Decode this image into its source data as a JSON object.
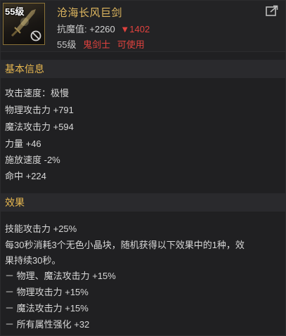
{
  "item": {
    "icon_level": "55级",
    "name": "沧海长风巨剑",
    "resist_label": "抗魔值:",
    "resist_value": "+2260",
    "resist_down": "▼1402",
    "level": "55级",
    "class": "鬼剑士",
    "usable": "可使用"
  },
  "colors": {
    "name": "#e0b860",
    "section_title": "#e8b850",
    "warning_red": "#e0423e",
    "text": "#d8d8d8"
  },
  "sections": {
    "basic_title": "基本信息",
    "effect_title": "效果"
  },
  "stats": [
    "攻击速度：极慢",
    "物理攻击力 +791",
    "魔法攻击力 +594",
    "力量 +46",
    "施放速度 -2%",
    "命中 +224"
  ],
  "effects": {
    "skill": "技能攻击力 +25%",
    "desc_line1": "每30秒消耗3个无色小晶块，随机获得以下效果中的1种，效",
    "desc_line2": "果持续30秒。",
    "options": [
      "－ 物理、魔法攻击力 +15%",
      "－ 物理攻击力 +15%",
      "－ 魔法攻击力 +15%",
      "－ 所有属性强化 +32"
    ]
  },
  "icons": {
    "weapon": "greatsword-icon",
    "no_use": "prohibited-icon",
    "share": "share-icon"
  }
}
